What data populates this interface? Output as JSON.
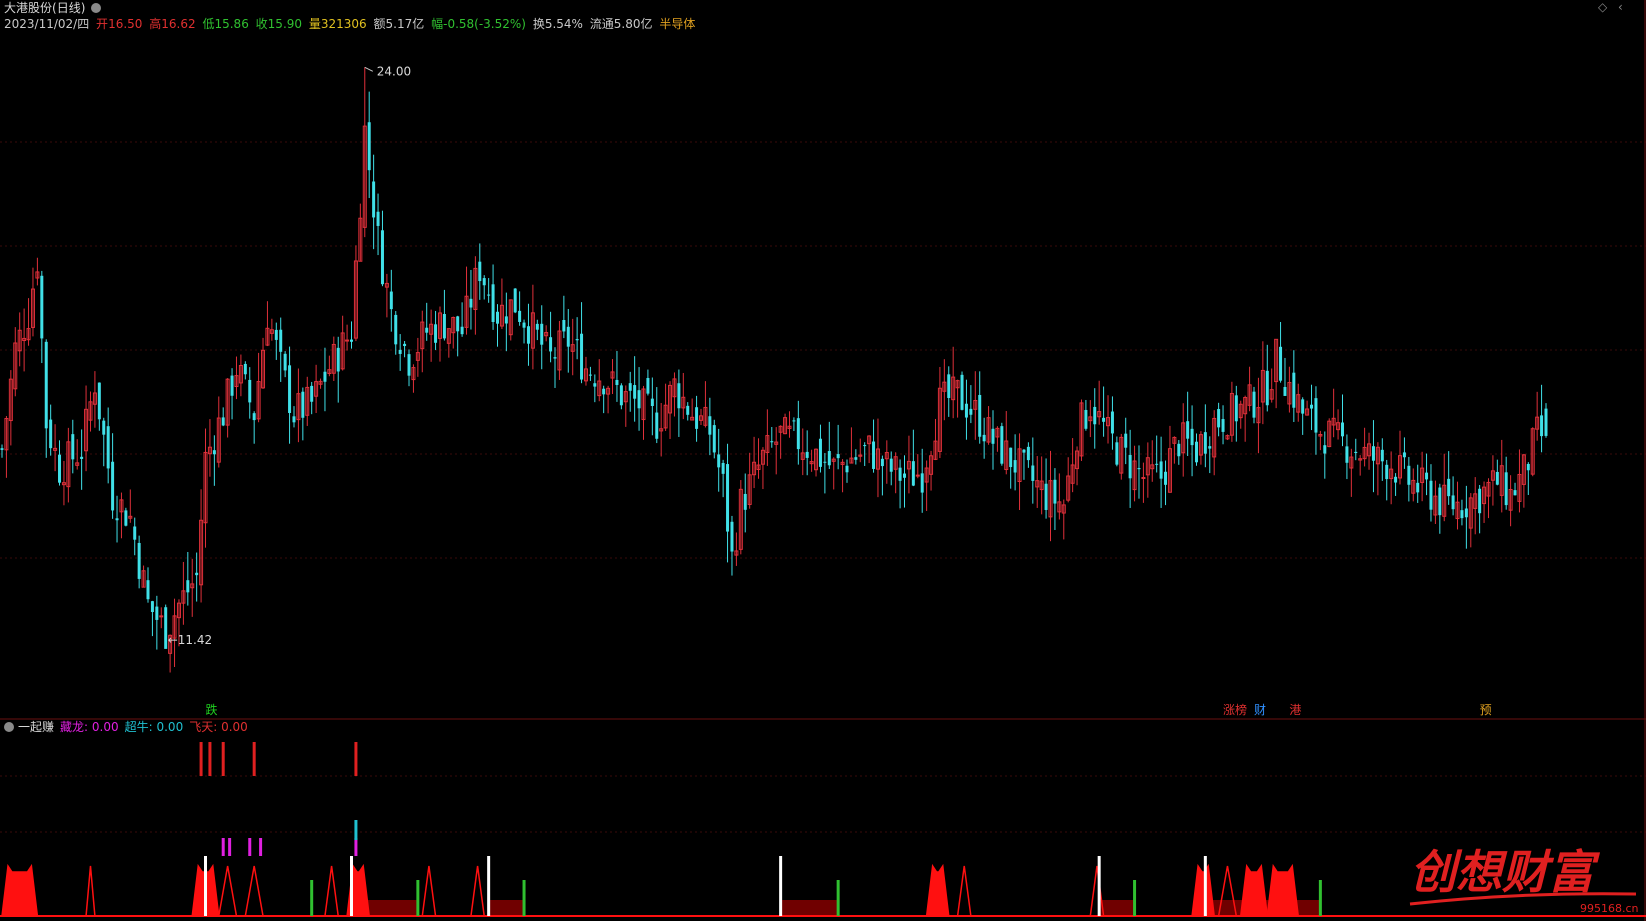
{
  "header": {
    "stock_name": "大港股份",
    "period": "(日线)",
    "date": "2023/11/02/四",
    "open": {
      "label": "开",
      "value": "16.50"
    },
    "high": {
      "label": "高",
      "value": "16.62"
    },
    "low": {
      "label": "低",
      "value": "15.86"
    },
    "close": {
      "label": "收",
      "value": "15.90"
    },
    "volume": {
      "label": "量",
      "value": "321306"
    },
    "amount": {
      "label": "额",
      "value": "5.17亿"
    },
    "change": {
      "label": "幅",
      "value": "-0.58(-3.52%)"
    },
    "turnover": {
      "label": "换",
      "value": "5.54%"
    },
    "float_cap": {
      "label": "流通",
      "value": "5.80亿"
    },
    "sector": "半导体"
  },
  "corner_icons": {
    "diamond": "◇",
    "chevron": "‹"
  },
  "indicator": {
    "name": "一起赚",
    "cang_long": {
      "label": "藏龙:",
      "value": "0.00",
      "color": "#e020e0"
    },
    "chao_niu": {
      "label": "超牛:",
      "value": "0.00",
      "color": "#20c0d0"
    },
    "fei_tian": {
      "label": "飞天:",
      "value": "0.00",
      "color": "#e03030"
    }
  },
  "event_markers": [
    {
      "text": "跌",
      "index": 46,
      "color": "#20d020"
    },
    {
      "text": "涨榜",
      "index": 276,
      "color": "#e03030"
    },
    {
      "text": "财",
      "index": 283,
      "color": "#3090ff"
    },
    {
      "text": "港",
      "index": 291,
      "color": "#e03030"
    },
    {
      "text": "预",
      "index": 334,
      "color": "#e0a020"
    }
  ],
  "watermark": {
    "text": "创想财富",
    "url": "995168.cn"
  },
  "colors": {
    "up": "#e0303a",
    "down": "#40e0e8",
    "grid": "#3a0000",
    "bg": "#000000"
  },
  "chart_data": {
    "type": "candlestick",
    "ylim": [
      10.8,
      24.6
    ],
    "price_labels": {
      "high": {
        "value": 24.0,
        "index": 82,
        "text": "24.00"
      },
      "low": {
        "value": 11.42,
        "index": 37,
        "text": "11.42"
      }
    },
    "anchors": [
      [
        0,
        15.6
      ],
      [
        3,
        17.8
      ],
      [
        6,
        18.6
      ],
      [
        8,
        19.8
      ],
      [
        10,
        16.2
      ],
      [
        13,
        15.2
      ],
      [
        18,
        15.6
      ],
      [
        21,
        17.1
      ],
      [
        25,
        14.6
      ],
      [
        29,
        14.1
      ],
      [
        33,
        12.2
      ],
      [
        37,
        11.6
      ],
      [
        40,
        12.2
      ],
      [
        44,
        12.8
      ],
      [
        46,
        15.4
      ],
      [
        50,
        16.4
      ],
      [
        53,
        17.4
      ],
      [
        57,
        16.4
      ],
      [
        60,
        18.6
      ],
      [
        63,
        17.4
      ],
      [
        66,
        16.4
      ],
      [
        70,
        16.6
      ],
      [
        74,
        17.4
      ],
      [
        79,
        18.2
      ],
      [
        82,
        22.6
      ],
      [
        85,
        20.2
      ],
      [
        88,
        18.6
      ],
      [
        92,
        17.6
      ],
      [
        96,
        18.2
      ],
      [
        100,
        18.4
      ],
      [
        104,
        18.2
      ],
      [
        108,
        19.6
      ],
      [
        112,
        18.6
      ],
      [
        116,
        18.8
      ],
      [
        120,
        18.2
      ],
      [
        124,
        17.6
      ],
      [
        128,
        18.0
      ],
      [
        132,
        17.4
      ],
      [
        136,
        17.2
      ],
      [
        140,
        16.8
      ],
      [
        144,
        16.6
      ],
      [
        148,
        16.2
      ],
      [
        152,
        17.0
      ],
      [
        156,
        16.4
      ],
      [
        160,
        16.0
      ],
      [
        163,
        14.8
      ],
      [
        165,
        13.2
      ],
      [
        167,
        14.4
      ],
      [
        169,
        14.8
      ],
      [
        172,
        15.4
      ],
      [
        176,
        15.9
      ],
      [
        180,
        15.8
      ],
      [
        184,
        15.5
      ],
      [
        188,
        15.2
      ],
      [
        192,
        15.4
      ],
      [
        196,
        15.6
      ],
      [
        200,
        15.2
      ],
      [
        204,
        15.0
      ],
      [
        208,
        15.1
      ],
      [
        212,
        16.6
      ],
      [
        216,
        16.8
      ],
      [
        220,
        16.4
      ],
      [
        224,
        15.8
      ],
      [
        228,
        15.4
      ],
      [
        232,
        15.0
      ],
      [
        236,
        14.6
      ],
      [
        240,
        14.4
      ],
      [
        243,
        16.0
      ],
      [
        246,
        16.6
      ],
      [
        250,
        15.9
      ],
      [
        254,
        15.4
      ],
      [
        258,
        15.0
      ],
      [
        262,
        15.0
      ],
      [
        266,
        15.8
      ],
      [
        270,
        15.6
      ],
      [
        274,
        16.2
      ],
      [
        278,
        16.4
      ],
      [
        282,
        16.6
      ],
      [
        286,
        17.0
      ],
      [
        288,
        17.6
      ],
      [
        291,
        17.0
      ],
      [
        294,
        16.4
      ],
      [
        298,
        16.0
      ],
      [
        302,
        15.8
      ],
      [
        306,
        15.6
      ],
      [
        310,
        15.4
      ],
      [
        314,
        15.3
      ],
      [
        318,
        14.9
      ],
      [
        322,
        14.7
      ],
      [
        326,
        14.4
      ],
      [
        330,
        14.4
      ],
      [
        334,
        14.6
      ],
      [
        338,
        14.9
      ],
      [
        341,
        14.6
      ],
      [
        344,
        15.1
      ],
      [
        347,
        15.9
      ]
    ],
    "ohlc_last": {
      "open": 16.5,
      "high": 16.62,
      "low": 15.86,
      "close": 15.9
    },
    "bar_count": 350,
    "x_range": [
      0,
      1546
    ],
    "signals": {
      "fei_tian_red": [
        45,
        47,
        50,
        57,
        80
      ],
      "cang_long_magenta": [
        50,
        51,
        56,
        58,
        80
      ],
      "chao_niu_cyan": [
        80
      ],
      "white_lines": [
        46,
        79,
        110,
        176,
        248,
        272
      ],
      "green_lines": [
        70,
        94,
        118,
        189,
        256,
        298
      ],
      "peak_zones": [
        [
          0,
          8
        ],
        [
          19,
          21
        ],
        [
          43,
          49
        ],
        [
          49,
          53
        ],
        [
          55,
          59
        ],
        [
          73,
          76
        ],
        [
          78,
          83
        ],
        [
          95,
          98
        ],
        [
          106,
          109
        ],
        [
          209,
          214
        ],
        [
          216,
          219
        ],
        [
          246,
          249
        ],
        [
          269,
          274
        ],
        [
          275,
          279
        ],
        [
          280,
          286
        ],
        [
          286,
          293
        ]
      ],
      "dark_zones": [
        [
          80,
          94
        ],
        [
          110,
          118
        ],
        [
          176,
          189
        ],
        [
          248,
          256
        ],
        [
          272,
          298
        ]
      ]
    }
  }
}
